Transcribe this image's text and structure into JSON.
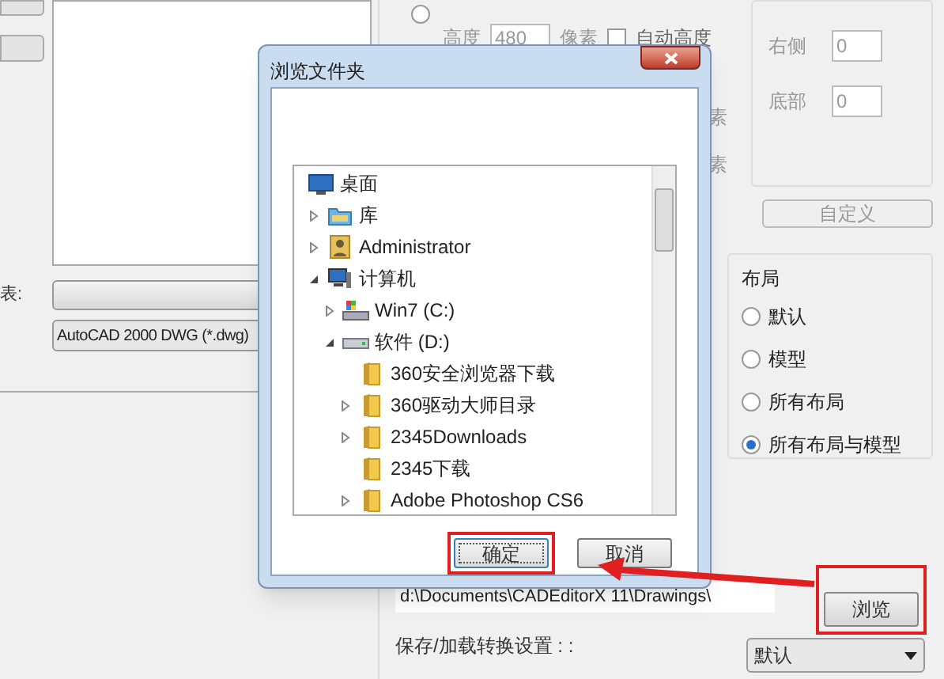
{
  "background": {
    "preview_label": "表:",
    "format_select": "AutoCAD 2000 DWG (*.dwg)",
    "size_radio": {
      "selected": false
    },
    "height_label": "高度",
    "height_value": "480",
    "height_unit": "像素",
    "auto_height": {
      "label": "自动高度",
      "checked": false
    },
    "pixel_labels": [
      "素",
      "素"
    ],
    "margins": [
      {
        "label": "右侧",
        "value": "0"
      },
      {
        "label": "底部",
        "value": "0"
      }
    ],
    "custom_button": "自定义",
    "layout": {
      "title": "布局",
      "options": [
        {
          "label": "默认",
          "selected": false
        },
        {
          "label": "模型",
          "selected": false
        },
        {
          "label": "所有布局",
          "selected": false
        },
        {
          "label": "所有布局与模型",
          "selected": true
        }
      ]
    },
    "output_path": "d:\\Documents\\CADEditorX 11\\Drawings\\",
    "browse_button": {
      "label": "浏览",
      "highlighted": true
    },
    "settings_label": "保存/加载转换设置 : :",
    "settings_select": "默认"
  },
  "dialog": {
    "title": "浏览文件夹",
    "tree": [
      {
        "kind": "desktop",
        "label": "桌面",
        "children": [
          {
            "kind": "library",
            "label": "库",
            "expanded": false
          },
          {
            "kind": "user",
            "label": "Administrator",
            "expanded": false
          },
          {
            "kind": "computer",
            "label": "计算机",
            "expanded": true,
            "children": [
              {
                "kind": "system-drive",
                "label": "Win7 (C:)",
                "expanded": false
              },
              {
                "kind": "drive",
                "label": "软件 (D:)",
                "expanded": true,
                "children": [
                  {
                    "kind": "folder",
                    "label": "360安全浏览器下载"
                  },
                  {
                    "kind": "folder",
                    "label": "360驱动大师目录",
                    "expanded": false
                  },
                  {
                    "kind": "folder",
                    "label": "2345Downloads",
                    "expanded": false
                  },
                  {
                    "kind": "folder",
                    "label": "2345下载"
                  },
                  {
                    "kind": "folder",
                    "label": "Adobe Photoshop CS6",
                    "expanded": false
                  }
                ]
              }
            ]
          }
        ]
      }
    ],
    "buttons": [
      {
        "label": "确定",
        "highlighted": true
      },
      {
        "label": "取消",
        "highlighted": false
      }
    ]
  }
}
